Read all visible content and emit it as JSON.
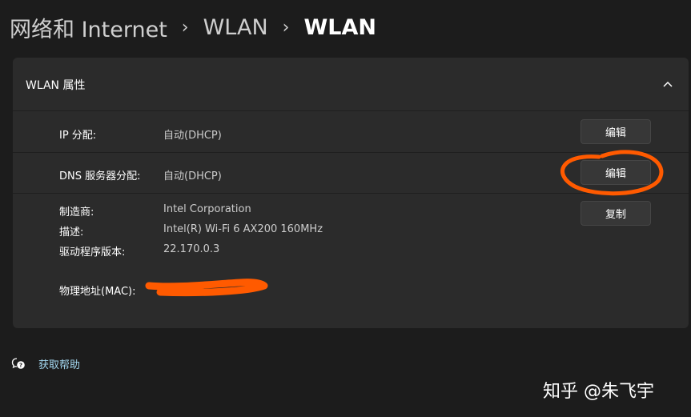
{
  "breadcrumb": {
    "items": [
      "网络和 Internet",
      "WLAN",
      "WLAN"
    ],
    "separator": "›"
  },
  "panel": {
    "title": "WLAN 属性",
    "rows": {
      "ip": {
        "label": "IP 分配:",
        "value": "自动(DHCP)",
        "button": "编辑"
      },
      "dns": {
        "label": "DNS 服务器分配:",
        "value": "自动(DHCP)",
        "button": "编辑"
      }
    },
    "info": {
      "manufacturer": {
        "label": "制造商:",
        "value": "Intel Corporation"
      },
      "description": {
        "label": "描述:",
        "value": "Intel(R) Wi-Fi 6 AX200 160MHz"
      },
      "driver": {
        "label": "驱动程序版本:",
        "value": "22.170.0.3"
      },
      "mac": {
        "label": "物理地址(MAC):",
        "value": ""
      }
    },
    "copy_button": "复制"
  },
  "help": {
    "label": "获取帮助",
    "icon": "help-chat-icon"
  },
  "watermark": "知乎 @朱飞宇",
  "colors": {
    "background": "#1c1c1c",
    "card": "#2b2b2b",
    "button": "#373737",
    "link": "#a3d7f0",
    "annotation": "#ff5a00"
  }
}
